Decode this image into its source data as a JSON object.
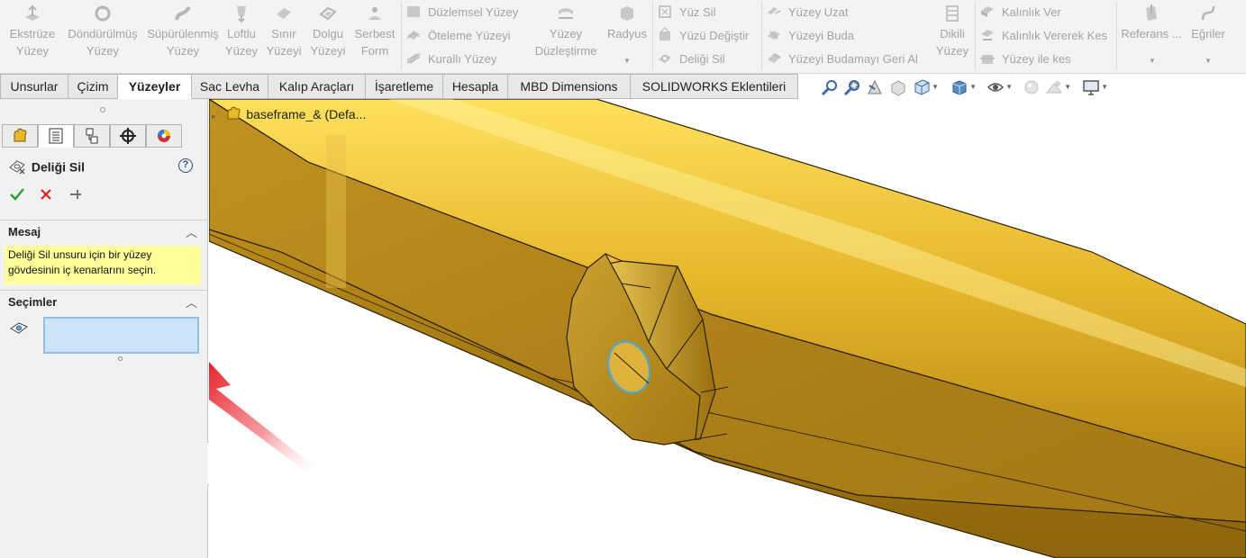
{
  "ribbon": {
    "buttons": [
      {
        "label": "Ekstrüze\nYüzey",
        "icon": "extruded-surface-icon"
      },
      {
        "label": "Döndürülmüş\nYüzey",
        "icon": "revolved-surface-icon"
      },
      {
        "label": "Süpürülenmiş\nYüzey",
        "icon": "swept-surface-icon"
      },
      {
        "label": "Loftlu\nYüzey",
        "icon": "lofted-surface-icon"
      },
      {
        "label": "Sınır\nYüzeyi",
        "icon": "boundary-surface-icon"
      },
      {
        "label": "Dolgu\nYüzeyi",
        "icon": "filled-surface-icon"
      },
      {
        "label": "Serbest\nForm",
        "icon": "freeform-icon"
      },
      {
        "label": "Yüzey\nDüzleştirme",
        "icon": "surface-flatten-icon"
      },
      {
        "label": "Radyus",
        "icon": "fillet-icon"
      },
      {
        "label": "Dikili\nYüzey",
        "icon": "ruled-surface-icon"
      },
      {
        "label": "Referans ...",
        "icon": "reference-geometry-icon"
      },
      {
        "label": "Eğriler",
        "icon": "curves-icon"
      }
    ],
    "small_buttons": [
      {
        "label": "Düzlemsel Yüzey",
        "icon": "planar-surface-icon"
      },
      {
        "label": "Öteleme Yüzeyi",
        "icon": "offset-surface-icon"
      },
      {
        "label": "Kurallı Yüzey",
        "icon": "ruled-surface-small-icon"
      },
      {
        "label": "Yüz Sil",
        "icon": "delete-face-icon"
      },
      {
        "label": "Yüzü Değiştir",
        "icon": "replace-face-icon"
      },
      {
        "label": "Deliği Sil",
        "icon": "delete-hole-icon"
      },
      {
        "label": "Yüzey Uzat",
        "icon": "extend-surface-icon"
      },
      {
        "label": "Yüzeyi Buda",
        "icon": "trim-surface-icon"
      },
      {
        "label": "Yüzeyi Budamayı Geri Al",
        "icon": "untrim-surface-icon"
      },
      {
        "label": "Kalınlık Ver",
        "icon": "thicken-icon"
      },
      {
        "label": "Kalınlık Vererek Kes",
        "icon": "thickened-cut-icon"
      },
      {
        "label": "Yüzey ile kes",
        "icon": "cut-with-surface-icon"
      }
    ]
  },
  "tabs": [
    {
      "label": "Unsurlar",
      "active": false
    },
    {
      "label": "Çizim",
      "active": false
    },
    {
      "label": "Yüzeyler",
      "active": true
    },
    {
      "label": "Sac Levha",
      "active": false
    },
    {
      "label": "Kalıp Araçları",
      "active": false
    },
    {
      "label": "İşaretleme",
      "active": false
    },
    {
      "label": "Hesapla",
      "active": false
    },
    {
      "label": "MBD Dimensions",
      "active": false
    },
    {
      "label": "SOLIDWORKS Eklentileri",
      "active": false
    }
  ],
  "view_toolbar": [
    "zoom-to-fit-icon",
    "zoom-to-area-icon",
    "previous-view-icon",
    "section-view-icon",
    "view-orientation-icon",
    "display-style-icon",
    "hide-show-items-icon",
    "edit-appearance-icon",
    "apply-scene-icon",
    "view-settings-icon"
  ],
  "panel": {
    "tab_icons": [
      "feature-manager-icon",
      "property-manager-icon",
      "configuration-manager-icon",
      "dimxpert-manager-icon",
      "display-manager-icon"
    ],
    "title": "Deliği Sil",
    "help_icon": "help-icon",
    "actions": [
      "ok-icon",
      "cancel-icon",
      "pin-icon"
    ],
    "message_header": "Mesaj",
    "message_text": "Deliği Sil unsuru için bir yüzey gövdesinin iç kenarlarını seçin.",
    "selections_header": "Seçimler"
  },
  "viewport": {
    "tree_label": "baseframe_&  (Defa...",
    "model_color": "#d4a019",
    "arrow_color": "#e8202a"
  }
}
